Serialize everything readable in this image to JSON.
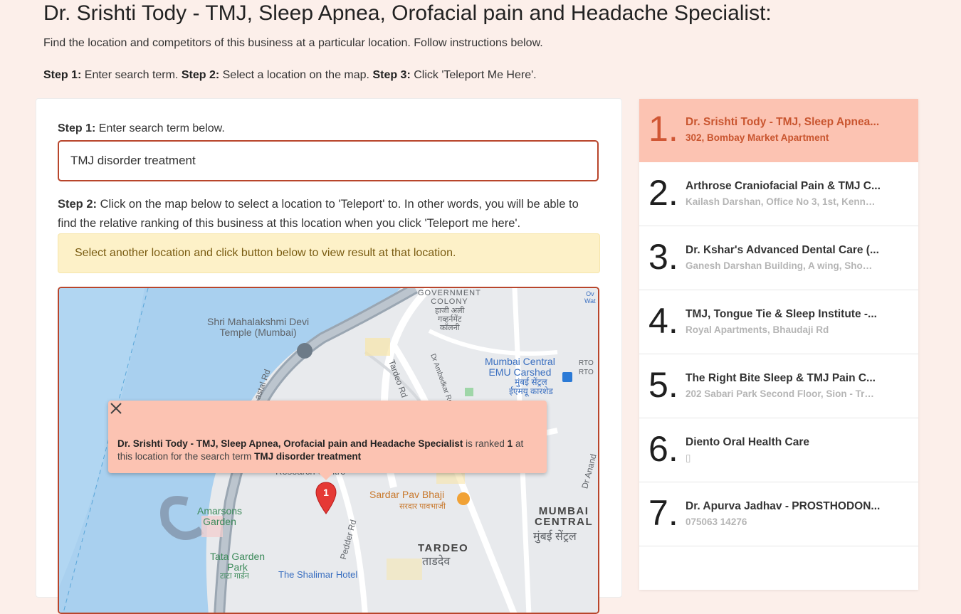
{
  "header": {
    "title": "Dr. Srishti Tody - TMJ, Sleep Apnea, Orofacial pain and Headache Specialist:",
    "intro": "Find the location and competitors of this business at a particular location. Follow instructions below.",
    "steps": {
      "s1_label": "Step 1:",
      "s1_text": " Enter search term. ",
      "s2_label": "Step 2:",
      "s2_text": " Select a location on the map. ",
      "s3_label": "Step 3:",
      "s3_text": " Click 'Teleport Me Here'."
    }
  },
  "form": {
    "step1_label": "Step 1:",
    "step1_text": " Enter search term below.",
    "search_value": "TMJ disorder treatment",
    "step2_label": "Step 2:",
    "step2_text": " Click on the map below to select a location to 'Teleport' to. In other words, you will be able to find the relative ranking of this business at this location when you click 'Teleport me here'.",
    "alert": "Select another location and click button below to view result at that location."
  },
  "map": {
    "labels": {
      "mahalakshmi": "Shri Mahalakshmi Devi\nTemple (Mumbai)",
      "govt_colony": "GOVERNMENT\nCOLONY",
      "govt_colony_hi": "हाजी अली\nगव्हर्नमेंट\nकॉलनी",
      "mumbai_central_emu": "Mumbai Central\nEMU Carshed",
      "mumbai_central_emu_hi": "मुंबई सेंट्रल\nईएमयू कारशेड",
      "rto": "RTO\nRTO",
      "tardeo_rd": "Tardeo Rd",
      "coastal_rd": "astal Rd",
      "dr_ambedkar": "Dr Ambedkar Rd",
      "dr_anand": "Dr Anand",
      "sardar": "Sardar Pav Bhaji",
      "sardar_hi": "सरदार पावभाजी",
      "amarsons": "Amarsons\nGarden",
      "mumbai_central": "MUMBAI\nCENTRAL",
      "mumbai_central_hi": "मुंबई सेंट्रल",
      "tardeo": "TARDEO",
      "tardeo_hi": "ताडदेव",
      "tata_garden": "Tata Garden\nPark",
      "tata_garden_hi": "टाटा गार्डन",
      "shalimar": "The Shalimar Hotel",
      "pedder": "Pedder Rd",
      "research": "Research Centre",
      "ov": "Ov\nWat"
    },
    "pin_label": "1",
    "popup": {
      "business": "Dr. Srishti Tody - TMJ, Sleep Apnea, Orofacial pain and Headache Specialist",
      "text1": " is ranked ",
      "rank": "1",
      "text2": " at this location for the search term ",
      "term": "TMJ disorder treatment"
    }
  },
  "ranking": [
    {
      "rank": "1",
      "name": "Dr. Srishti Tody - TMJ, Sleep Apnea...",
      "address": "302, Bombay Market Apartment"
    },
    {
      "rank": "2",
      "name": "Arthrose Craniofacial Pain & TMJ C...",
      "address": "Kailash Darshan, Office No 3, 1st, Kenned..."
    },
    {
      "rank": "3",
      "name": "Dr. Kshar's Advanced Dental Care (...",
      "address": "Ganesh Darshan Building, A wing, Shop n..."
    },
    {
      "rank": "4",
      "name": "TMJ, Tongue Tie & Sleep Institute -...",
      "address": "Royal Apartments, Bhaudaji Rd"
    },
    {
      "rank": "5",
      "name": "The Right Bite Sleep & TMJ Pain C...",
      "address": "202 Sabari Park Second Floor, Sion - Tro..."
    },
    {
      "rank": "6",
      "name": "Diento Oral Health Care",
      "address": "▯"
    },
    {
      "rank": "7",
      "name": "Dr. Apurva Jadhav - PROSTHODON...",
      "address": "075063 14276"
    }
  ]
}
